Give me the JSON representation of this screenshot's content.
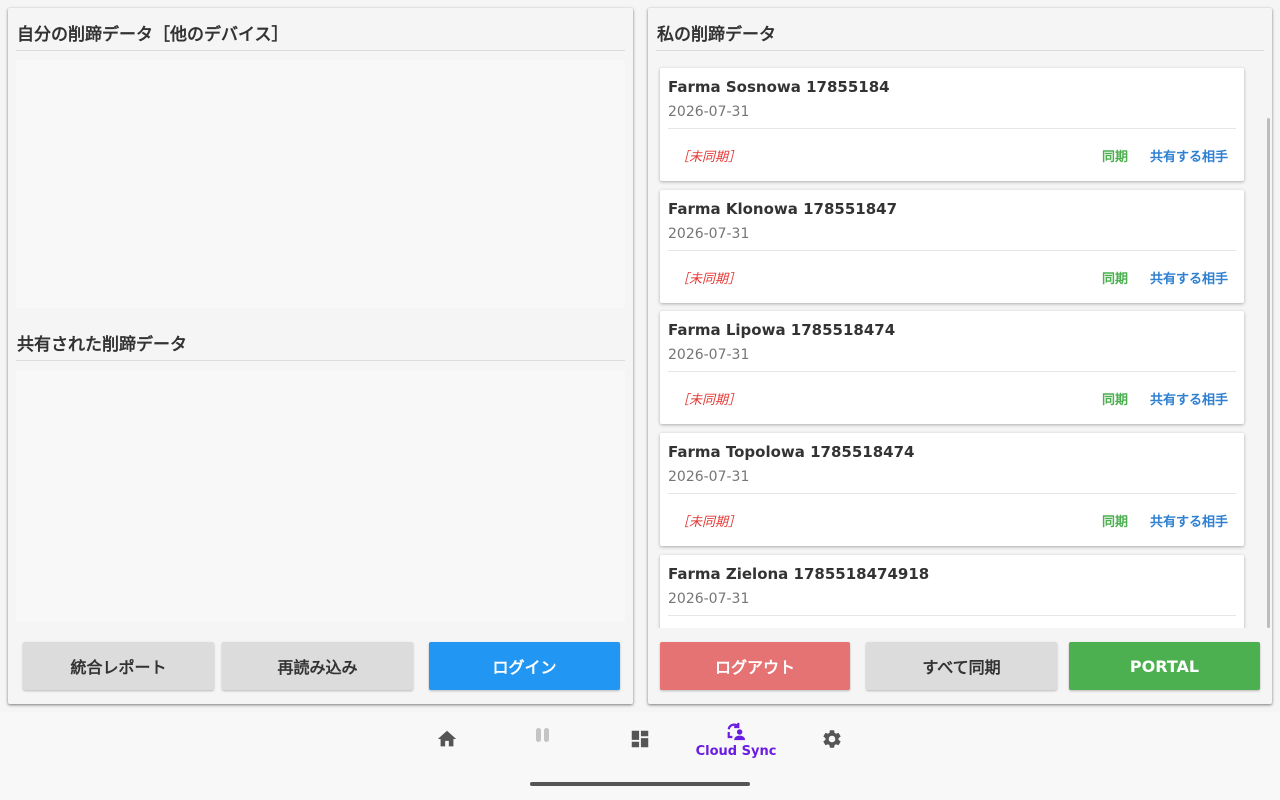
{
  "left_panel": {
    "section1_title": "自分の削蹄データ［他のデバイス］",
    "section2_title": "共有された削蹄データ",
    "buttons": {
      "report": "統合レポート",
      "reload": "再読み込み",
      "login": "ログイン"
    }
  },
  "right_panel": {
    "title": "私の削蹄データ",
    "cards": [
      {
        "title": "Farma Sosnowa 17855184",
        "date": "2026-07-31",
        "status": "［未同期］",
        "sync": "同期",
        "share": "共有する相手"
      },
      {
        "title": "Farma Klonowa 178551847",
        "date": "2026-07-31",
        "status": "［未同期］",
        "sync": "同期",
        "share": "共有する相手"
      },
      {
        "title": "Farma Lipowa 1785518474",
        "date": "2026-07-31",
        "status": "［未同期］",
        "sync": "同期",
        "share": "共有する相手"
      },
      {
        "title": "Farma Topolowa 1785518474",
        "date": "2026-07-31",
        "status": "［未同期］",
        "sync": "同期",
        "share": "共有する相手"
      },
      {
        "title": "Farma Zielona 1785518474918",
        "date": "2026-07-31",
        "status": "",
        "sync": "",
        "share": ""
      }
    ],
    "buttons": {
      "logout": "ログアウト",
      "sync_all": "すべて同期",
      "portal": "PORTAL"
    }
  },
  "bottom_nav": {
    "items": [
      {
        "icon": "home-icon",
        "label": ""
      },
      {
        "icon": "pause-icon",
        "label": ""
      },
      {
        "icon": "dashboard-icon",
        "label": ""
      },
      {
        "icon": "cloud-sync-icon",
        "label": "Cloud Sync",
        "active": true
      },
      {
        "icon": "gear-icon",
        "label": ""
      }
    ]
  },
  "colors": {
    "primary_blue": "#2196f3",
    "logout_red": "#e57373",
    "portal_green": "#4caf50",
    "unsynced_red": "#e53935",
    "sync_green": "#4caf50",
    "share_blue": "#2f80d1",
    "active_nav": "#6a1de0"
  }
}
